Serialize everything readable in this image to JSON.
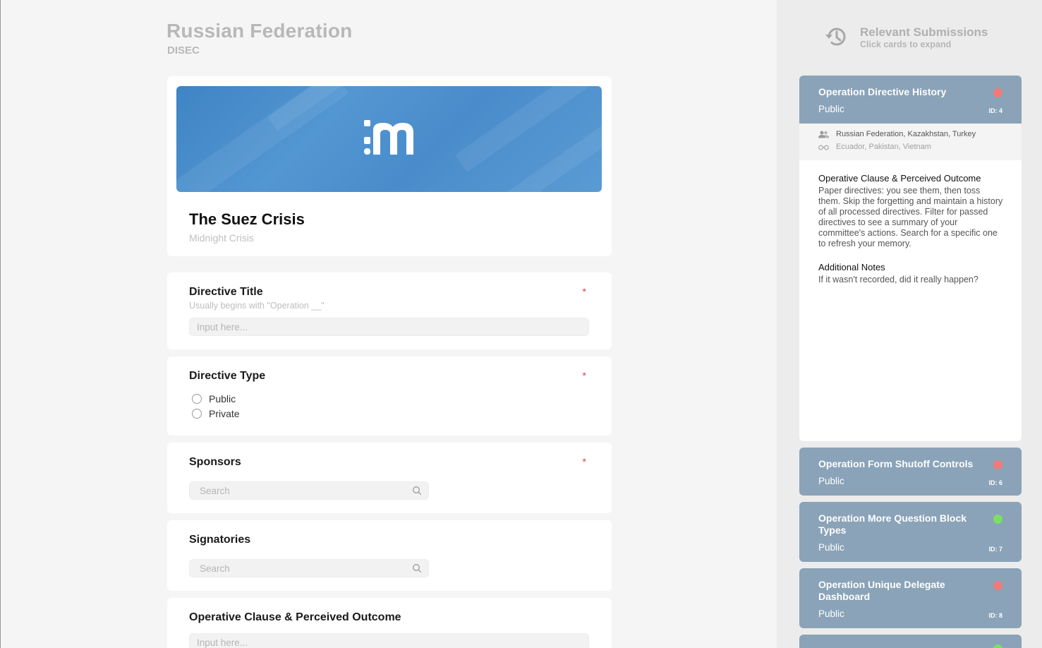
{
  "header": {
    "country": "Russian Federation",
    "committee": "DISEC"
  },
  "conference": {
    "title": "The Suez Crisis",
    "subtitle": "Midnight Crisis"
  },
  "form": {
    "directive_title": {
      "label": "Directive Title",
      "help": "Usually begins with \"Operation __\"",
      "placeholder": "Input here...",
      "required": "*"
    },
    "directive_type": {
      "label": "Directive Type",
      "required": "*",
      "options": [
        "Public",
        "Private"
      ]
    },
    "sponsors": {
      "label": "Sponsors",
      "required": "*",
      "placeholder": "Search"
    },
    "signatories": {
      "label": "Signatories",
      "placeholder": "Search"
    },
    "operative_clause": {
      "label": "Operative Clause & Perceived Outcome",
      "placeholder": "Input here..."
    }
  },
  "sidebar": {
    "title": "Relevant Submissions",
    "subtitle": "Click cards to expand",
    "icon": "history-icon",
    "colors": {
      "card": "#8aa3b8",
      "red": "#f07a7a",
      "green": "#7be05f"
    },
    "expanded": {
      "title": "Operation Directive History",
      "visibility": "Public",
      "id": "ID: 4",
      "status": "red",
      "sponsors": "Russian Federation, Kazakhstan, Turkey",
      "signatories": "Ecuador, Pakistan, Vietnam",
      "clause_heading": "Operative Clause & Perceived Outcome",
      "clause_text": "Paper directives: you see them, then toss them. Skip the forgetting and maintain a history of all processed directives. Filter for passed directives to see a summary of your committee's actions. Search for a specific one to refresh your memory.",
      "notes_heading": "Additional Notes",
      "notes_text": "If it wasn't recorded, did it really happen?"
    },
    "cards": [
      {
        "title": "Operation Form Shutoff Controls",
        "visibility": "Public",
        "id": "ID: 6",
        "status": "red"
      },
      {
        "title": "Operation More Question Block Types",
        "visibility": "Public",
        "id": "ID: 7",
        "status": "green"
      },
      {
        "title": "Operation Unique Delegate Dashboard",
        "visibility": "Public",
        "id": "ID: 8",
        "status": "red"
      },
      {
        "status": "green"
      }
    ]
  }
}
